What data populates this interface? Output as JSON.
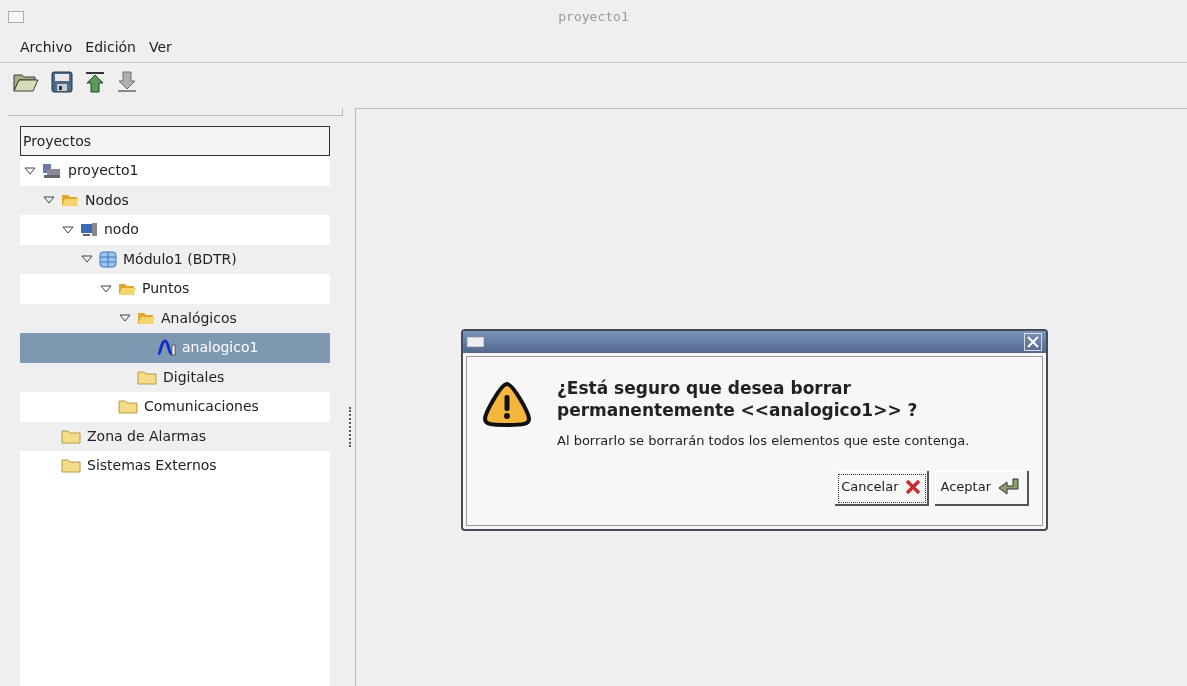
{
  "window": {
    "title": "proyecto1"
  },
  "menu": [
    {
      "label": "Archivo"
    },
    {
      "label": "Edición"
    },
    {
      "label": "Ver"
    }
  ],
  "toolbar": [
    {
      "kind": "open"
    },
    {
      "kind": "save"
    },
    {
      "kind": "upload"
    },
    {
      "kind": "download"
    }
  ],
  "tree": {
    "header": "Proyectos",
    "items": [
      {
        "label": "proyecto1",
        "kind": "network",
        "expanded": true,
        "selected": false,
        "children": [
          {
            "label": "Nodos",
            "kind": "folder-open",
            "expanded": true,
            "selected": false,
            "children": [
              {
                "label": "nodo",
                "kind": "computer",
                "expanded": true,
                "selected": false,
                "children": [
                  {
                    "label": "Módulo1  (BDTR)",
                    "kind": "database",
                    "expanded": true,
                    "selected": false,
                    "children": [
                      {
                        "label": "Puntos",
                        "kind": "folder-open",
                        "expanded": true,
                        "selected": false,
                        "children": [
                          {
                            "label": "Analógicos",
                            "kind": "folder-open",
                            "expanded": true,
                            "selected": false,
                            "children": [
                              {
                                "label": "analogico1",
                                "kind": "wave",
                                "selected": true
                              }
                            ]
                          },
                          {
                            "label": "Digitales",
                            "kind": "folder",
                            "selected": false
                          }
                        ]
                      },
                      {
                        "label": "Comunicaciones",
                        "kind": "folder",
                        "selected": false
                      }
                    ]
                  }
                ]
              }
            ]
          },
          {
            "label": "Zona de Alarmas",
            "kind": "folder",
            "selected": false
          },
          {
            "label": "Sistemas Externos",
            "kind": "folder",
            "selected": false
          }
        ]
      }
    ]
  },
  "dialog": {
    "question": "¿Está seguro que desea borrar permanentemente <<analogico1>> ?",
    "detail": "Al borrarlo se borrarán todos los elementos que este contenga.",
    "buttons": [
      {
        "label": "Cancelar",
        "kind": "cancel",
        "focused": true
      },
      {
        "label": "Aceptar",
        "kind": "ok",
        "focused": false
      }
    ]
  }
}
